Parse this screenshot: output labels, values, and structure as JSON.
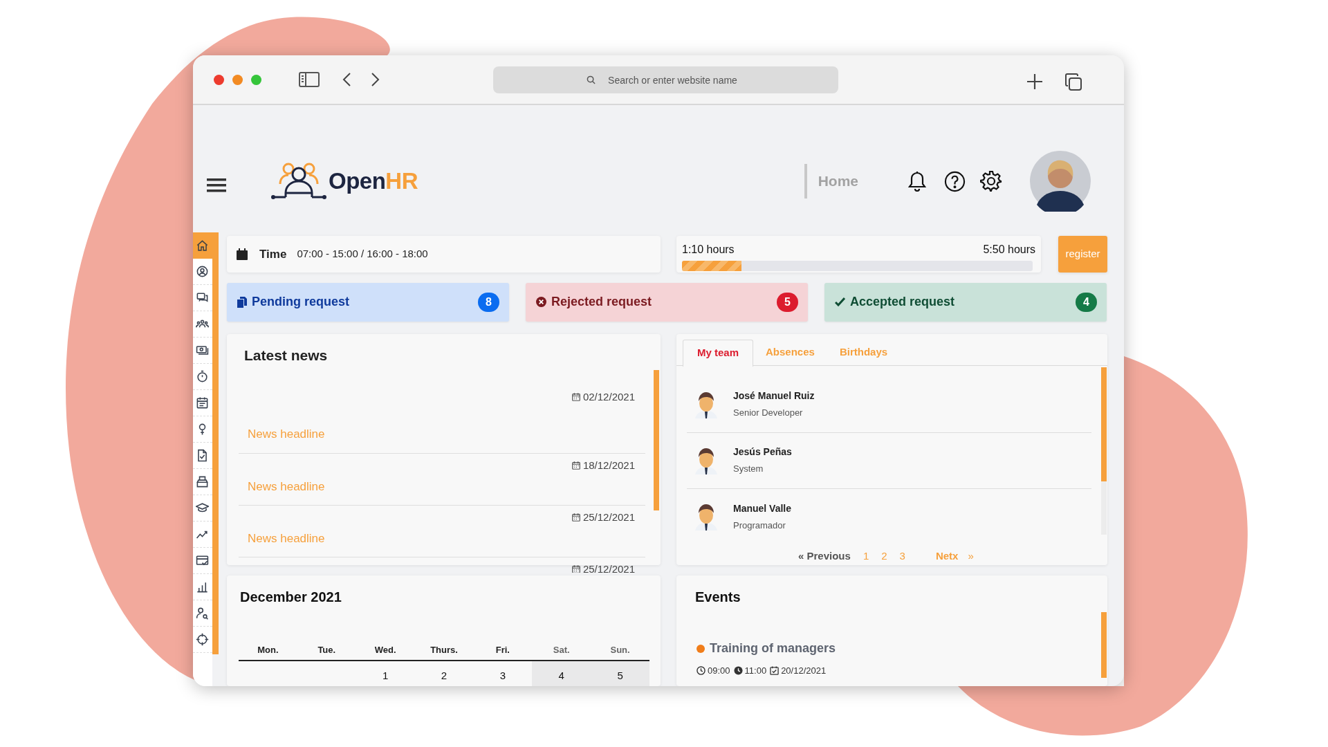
{
  "browser": {
    "search": {
      "placeholder": "Search or enter website name"
    }
  },
  "header": {
    "logo": {
      "text": "Open",
      "accent": "HR"
    },
    "nav": "Home"
  },
  "sidebar": {
    "items": [
      {
        "selected": true
      },
      {
        "selected": false
      },
      {
        "selected": false
      },
      {
        "selected": false
      },
      {
        "selected": false
      },
      {
        "selected": false
      },
      {
        "selected": false
      },
      {
        "selected": false
      },
      {
        "selected": false
      },
      {
        "selected": false
      },
      {
        "selected": false
      },
      {
        "selected": false
      },
      {
        "selected": false
      },
      {
        "selected": false
      },
      {
        "selected": false
      },
      {
        "selected": false
      }
    ]
  },
  "time": {
    "label": "Time",
    "value": "07:00 - 15:00 / 16:00 - 18:00"
  },
  "progress": {
    "start": "1:10 hours",
    "end": "5:50 hours",
    "level": 0.17
  },
  "register_button": "register",
  "requests": [
    {
      "kind": "pending",
      "label": "Pending request",
      "count": "8"
    },
    {
      "kind": "rejected",
      "label": "Rejected request",
      "count": "5"
    },
    {
      "kind": "accepted",
      "label": "Accepted request",
      "count": "4"
    }
  ],
  "news": {
    "title": "Latest news",
    "items": [
      {
        "date": "02/12/2021",
        "headline": "News headline"
      },
      {
        "date": "18/12/2021",
        "headline": "News headline"
      },
      {
        "date": "25/12/2021",
        "headline": "News headline"
      },
      {
        "date": "25/12/2021"
      }
    ]
  },
  "team": {
    "tabs": [
      {
        "label": "My team",
        "selected": true
      },
      {
        "label": "Absences",
        "selected": false
      },
      {
        "label": "Birthdays",
        "selected": false
      }
    ],
    "members": [
      {
        "name": "José Manuel Ruiz",
        "role": "Senior Developer"
      },
      {
        "name": "Jesús Peñas",
        "role": "System"
      },
      {
        "name": "Manuel Valle",
        "role": "Programador"
      }
    ],
    "pagination": {
      "previous": "« Previous",
      "pages": [
        "1",
        "2",
        "3"
      ],
      "next": "Netx",
      "next_icon": "»"
    }
  },
  "calendar": {
    "title": "December 2021",
    "weekdays": [
      {
        "label": "Mon.",
        "weekend": false
      },
      {
        "label": "Tue.",
        "weekend": false
      },
      {
        "label": "Wed.",
        "weekend": false
      },
      {
        "label": "Thurs.",
        "weekend": false
      },
      {
        "label": "Fri.",
        "weekend": false
      },
      {
        "label": "Sat.",
        "weekend": true
      },
      {
        "label": "Sun.",
        "weekend": true
      }
    ],
    "days": [
      {
        "label": "1",
        "weekend": false
      },
      {
        "label": "2",
        "weekend": false
      },
      {
        "label": "3",
        "weekend": false
      },
      {
        "label": "4",
        "weekend": true
      },
      {
        "label": "5",
        "weekend": true
      }
    ]
  },
  "events": {
    "title": "Events",
    "items": [
      {
        "title": "Training of managers",
        "color": "#f07d1a",
        "start": "09:00",
        "end": "11:00",
        "date": "20/12/2021"
      }
    ]
  }
}
